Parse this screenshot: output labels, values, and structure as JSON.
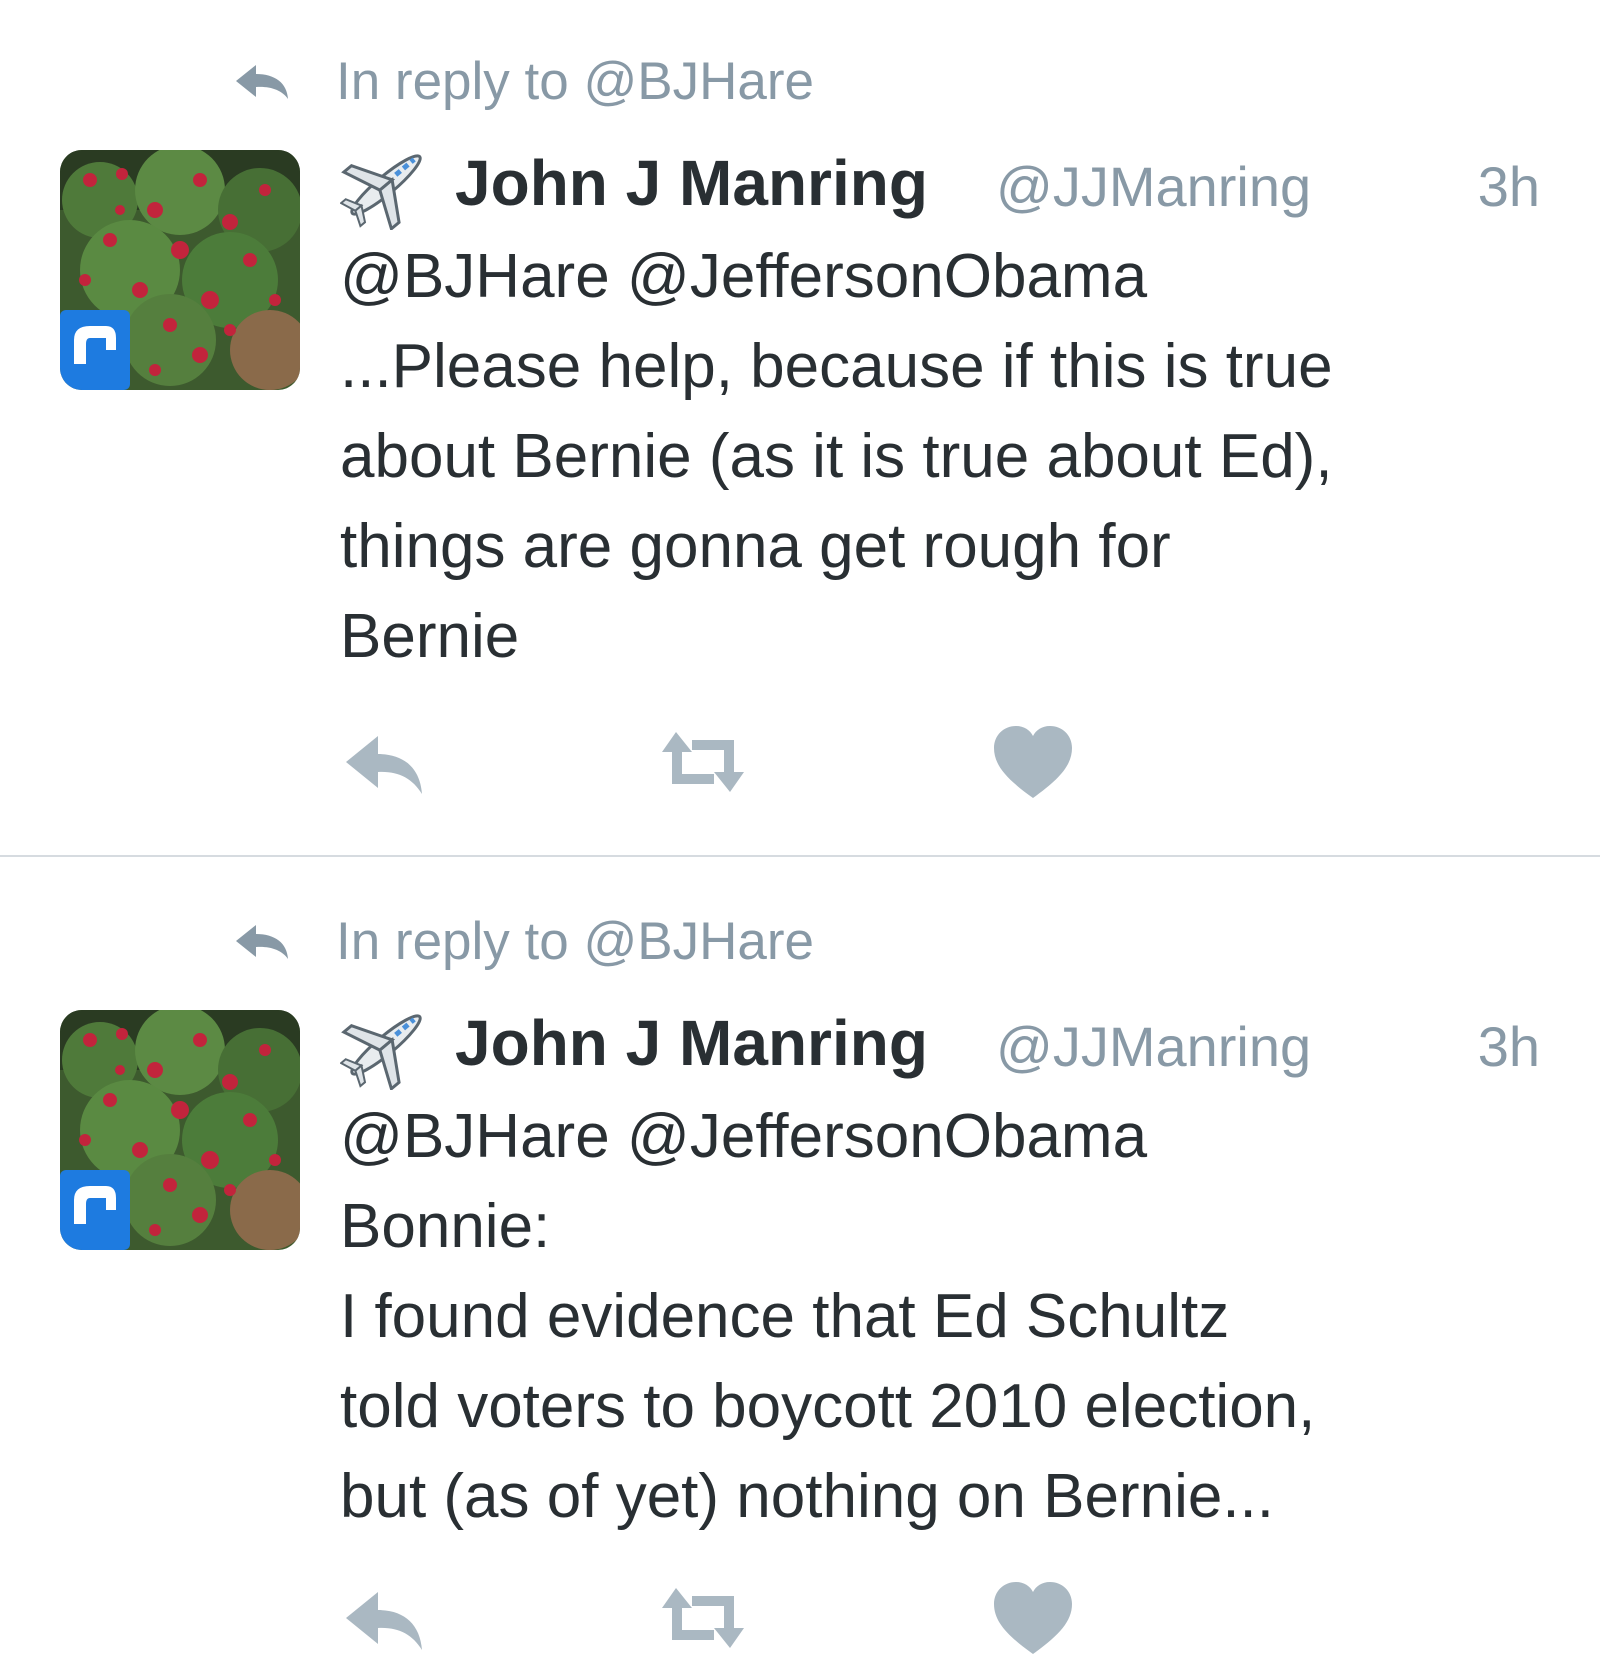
{
  "colors": {
    "text": "#292f33",
    "secondary": "#8899a6",
    "icon": "#aab8c2",
    "divider": "#d6dbe0"
  },
  "tweets": [
    {
      "reply_context": "In reply to @BJHare",
      "display_name": "John J Manring",
      "handle": "@JJManring",
      "timestamp": "3h",
      "text_lines": [
        "@BJHare @JeffersonObama",
        "...Please help, because if this is true",
        "about Bernie (as it is true about Ed),",
        "things are gonna get rough for",
        "Bernie"
      ],
      "actions": [
        "reply-icon",
        "retweet-icon",
        "heart-icon"
      ]
    },
    {
      "reply_context": "In reply to @BJHare",
      "display_name": "John J Manring",
      "handle": "@JJManring",
      "timestamp": "3h",
      "text_lines": [
        "@BJHare @JeffersonObama",
        "Bonnie:",
        "I found evidence that Ed Schultz",
        "told voters to boycott 2010 election,",
        "but (as of yet) nothing on Bernie..."
      ],
      "actions": [
        "reply-icon",
        "retweet-icon",
        "heart-icon"
      ]
    }
  ]
}
